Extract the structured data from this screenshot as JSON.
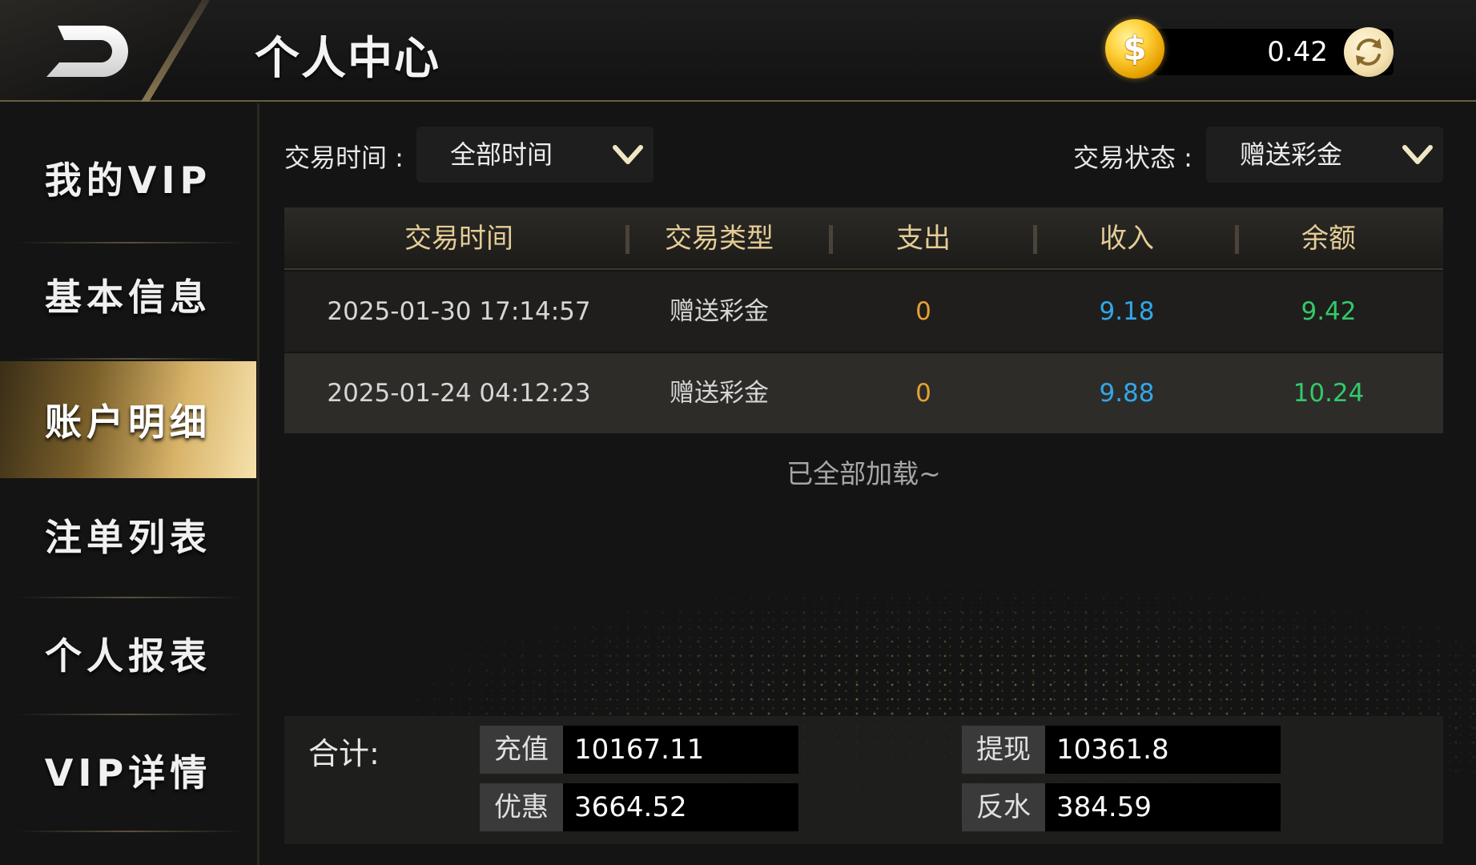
{
  "header": {
    "title": "个人中心",
    "balance": "0.42",
    "coin_symbol": "$"
  },
  "sidebar": {
    "items": [
      {
        "label": "我的VIP",
        "active": false
      },
      {
        "label": "基本信息",
        "active": false
      },
      {
        "label": "账户明细",
        "active": true
      },
      {
        "label": "注单列表",
        "active": false
      },
      {
        "label": "个人报表",
        "active": false
      },
      {
        "label": "VIP详情",
        "active": false
      }
    ]
  },
  "filters": {
    "time_label": "交易时间 :",
    "time_value": "全部时间",
    "status_label": "交易状态 :",
    "status_value": "赠送彩金"
  },
  "table": {
    "columns": [
      "交易时间",
      "交易类型",
      "支出",
      "收入",
      "余额"
    ],
    "rows": [
      {
        "time": "2025-01-30 17:14:57",
        "type": "赠送彩金",
        "out": "0",
        "in": "9.18",
        "balance": "9.42"
      },
      {
        "time": "2025-01-24 04:12:23",
        "type": "赠送彩金",
        "out": "0",
        "in": "9.88",
        "balance": "10.24"
      }
    ],
    "footer_note": "已全部加载~"
  },
  "summary": {
    "title": "合计:",
    "recharge_label": "充值",
    "recharge_value": "10167.11",
    "withdraw_label": "提现",
    "withdraw_value": "10361.8",
    "discount_label": "优惠",
    "discount_value": "3664.52",
    "rebate_label": "反水",
    "rebate_value": "384.59"
  },
  "colors": {
    "accent_gold": "#e4cc95",
    "expense": "#e7a033",
    "income": "#33a6ea",
    "balance": "#33c96a"
  },
  "icons": [
    "back-icon",
    "coin-icon",
    "refresh-icon",
    "chevron-down-icon"
  ]
}
